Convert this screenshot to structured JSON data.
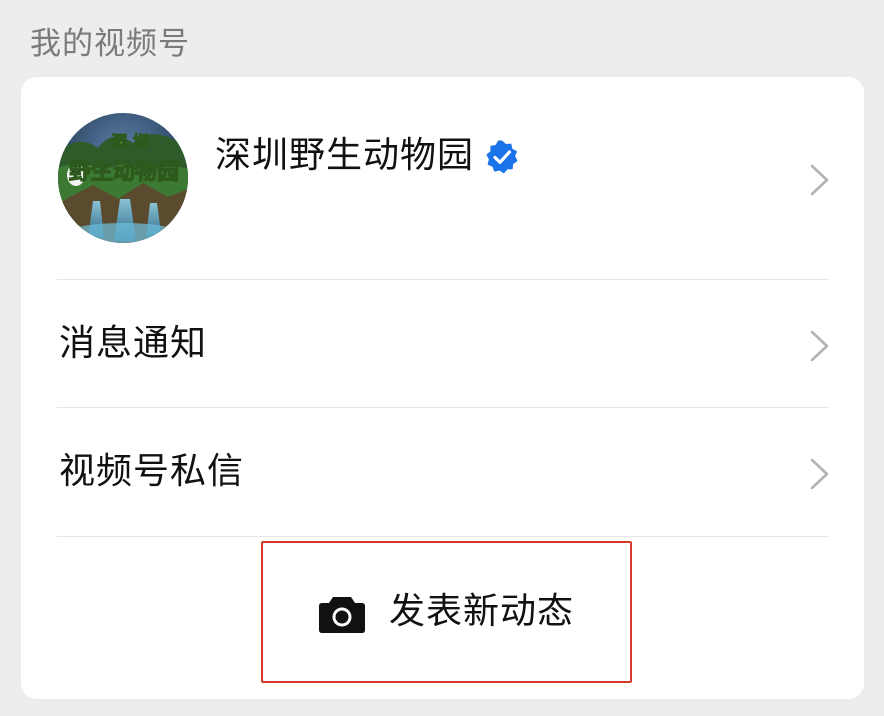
{
  "section": {
    "title": "我的视频号"
  },
  "profile": {
    "name": "深圳野生动物园",
    "avatar_text": "深圳 野生动物园",
    "verified": true,
    "icon": "verified-badge-icon"
  },
  "menu": {
    "items": [
      {
        "label": "消息通知",
        "icon": "chevron-right-icon"
      },
      {
        "label": "视频号私信",
        "icon": "chevron-right-icon"
      }
    ]
  },
  "post": {
    "label": "发表新动态",
    "icon": "camera-icon"
  },
  "colors": {
    "background": "#ededed",
    "card": "#ffffff",
    "accent_blue": "#1a73e8",
    "highlight_red": "#d63a2f",
    "text_primary": "#111111",
    "text_secondary": "#7b7b7b"
  }
}
